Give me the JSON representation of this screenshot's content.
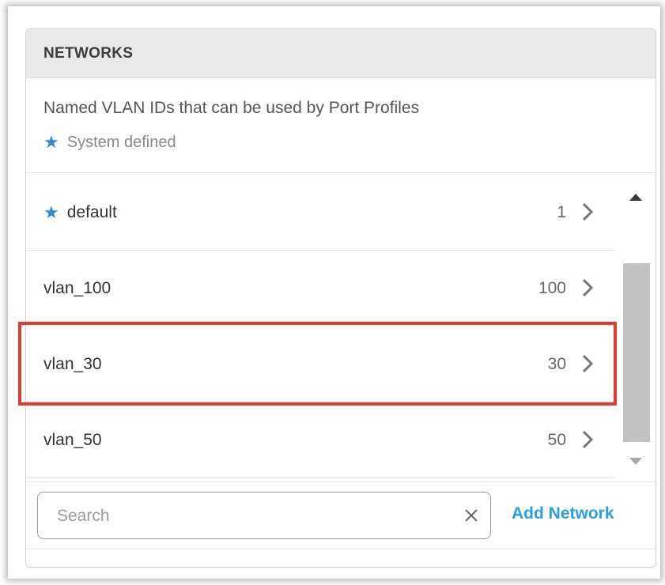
{
  "panel": {
    "title": "NETWORKS",
    "description": "Named VLAN IDs that can be used by Port Profiles",
    "legend_label": "System defined",
    "legend_star": "★"
  },
  "networks": [
    {
      "name": "default",
      "vlan_id": "1",
      "system_defined": true,
      "star": "★"
    },
    {
      "name": "vlan_100",
      "vlan_id": "100",
      "system_defined": false
    },
    {
      "name": "vlan_30",
      "vlan_id": "30",
      "system_defined": false,
      "highlighted": true
    },
    {
      "name": "vlan_50",
      "vlan_id": "50",
      "system_defined": false
    }
  ],
  "search": {
    "placeholder": "Search",
    "value": ""
  },
  "actions": {
    "add_network": "Add Network"
  },
  "colors": {
    "accent": "#2b9fe0",
    "star": "#2e8ad8",
    "highlight": "#e03a31"
  }
}
